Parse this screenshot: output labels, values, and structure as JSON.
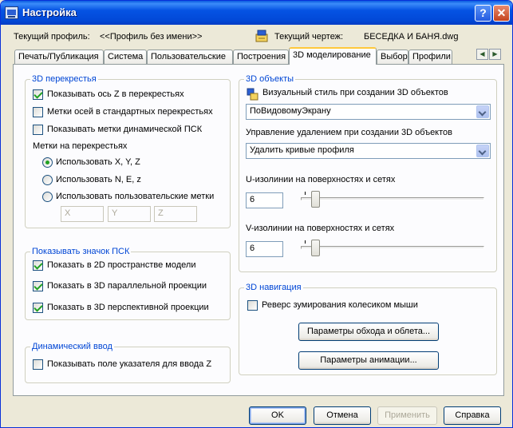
{
  "window": {
    "title": "Настройка",
    "help_glyph": "?",
    "close_glyph": "✕"
  },
  "header": {
    "profile_label": "Текущий профиль:",
    "profile_value": "<<Профиль без имени>>",
    "drawing_label": "Текущий чертеж:",
    "drawing_value": "БЕСЕДКА И БАНЯ.dwg"
  },
  "tabs": [
    {
      "label": "Печать/Публикация"
    },
    {
      "label": "Система"
    },
    {
      "label": "Пользовательские"
    },
    {
      "label": "Построения"
    },
    {
      "label": "3D моделирование",
      "active": true
    },
    {
      "label": "Выбор"
    },
    {
      "label": "Профили"
    }
  ],
  "crosshair_group": {
    "title": "3D перекрестья",
    "show_z": {
      "label": "Показывать ось Z в перекрестьях",
      "checked": true
    },
    "axis_labels": {
      "label": "Метки осей в стандартных перекрестьях",
      "checked": false
    },
    "dynamic_ucs": {
      "label": "Показывать метки динамической ПСК",
      "checked": false
    },
    "labels_title": "Метки на перекрестьях",
    "radio_xyz": {
      "label": "Использовать X, Y, Z",
      "selected": true
    },
    "radio_nez": {
      "label": "Использовать N, E, z",
      "selected": false
    },
    "radio_custom": {
      "label": "Использовать пользовательские метки",
      "selected": false
    },
    "custom_x": "X",
    "custom_y": "Y",
    "custom_z": "Z"
  },
  "ucs_icon_group": {
    "title": "Показывать значок ПСК",
    "in_2d": {
      "label": "Показать в 2D пространстве модели",
      "checked": true
    },
    "in_3d_parallel": {
      "label": "Показать в 3D параллельной проекции",
      "checked": true
    },
    "in_3d_perspective": {
      "label": "Показать в 3D перспективной проекции",
      "checked": true
    }
  },
  "dynamic_input_group": {
    "title": "Динамический ввод",
    "pointer_z": {
      "label": "Показывать поле указателя для ввода Z",
      "checked": false
    }
  },
  "objects_group": {
    "title": "3D объекты",
    "visual_style_label": "Визуальный стиль при создании 3D объектов",
    "visual_style_value": "ПоВидовомуЭкрану",
    "deletion_label": "Управление удалением при создании 3D объектов",
    "deletion_value": "Удалить кривые профиля",
    "u_isolines_label": "U-изолинии на поверхностях и сетях",
    "u_isolines_value": "6",
    "u_level": 0.06,
    "v_isolines_label": "V-изолинии на поверхностях и сетях",
    "v_isolines_value": "6",
    "v_level": 0.06
  },
  "navigation_group": {
    "title": "3D навигация",
    "reverse_zoom": {
      "label": "Реверс зумирования колесиком мыши",
      "checked": false
    },
    "walk_fly_button": "Параметры обхода и облета...",
    "animation_button": "Параметры анимации..."
  },
  "footer": {
    "ok": "OK",
    "cancel": "Отмена",
    "apply": "Применить",
    "help": "Справка"
  },
  "colors": {
    "group_title": "#0046d5",
    "check_mark": "#21a121",
    "titlebar": "#0553e3"
  }
}
